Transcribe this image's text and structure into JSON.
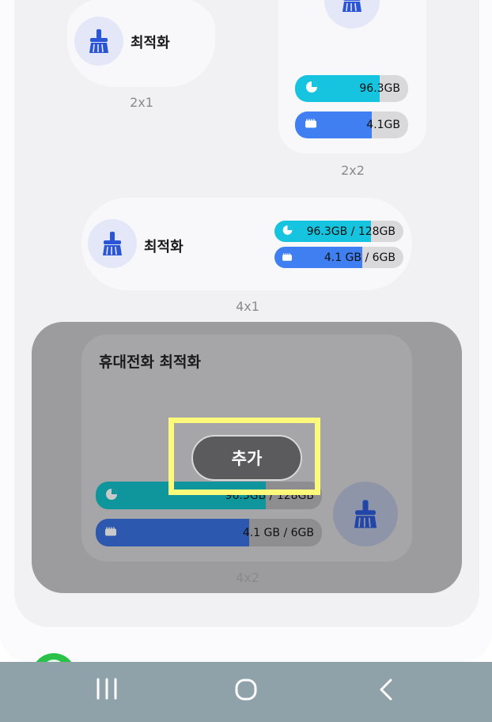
{
  "widgets": {
    "w2x1": {
      "title": "최적화",
      "size": "2x1"
    },
    "w2x2": {
      "storage_value": "96.3GB",
      "ram_value": "4.1GB",
      "size": "2x2",
      "storage_fill": 0.75,
      "ram_fill": 0.68
    },
    "w4x1": {
      "title": "최적화",
      "storage_value": "96.3GB / 128GB",
      "ram_value": "4.1 GB / 6GB",
      "size": "4x1",
      "storage_fill": 0.75,
      "ram_fill": 0.68
    },
    "w4x2": {
      "title": "휴대전화 최적화",
      "storage_value": "96.3GB / 128GB",
      "ram_value": "4.1 GB / 6GB",
      "size": "4x2",
      "add_label": "추가",
      "storage_fill": 0.75,
      "ram_fill": 0.68
    }
  },
  "colors": {
    "storage": "#17c4df",
    "ram": "#3f7ff2",
    "storage_dim": "#0f959c",
    "ram_dim": "#2c58b0",
    "brush": "#2a55d6",
    "highlight": "#fdf97a",
    "navbar": "#8fa2aa"
  },
  "icons": [
    "broom-icon",
    "pie-chart-icon",
    "memory-chip-icon",
    "recent-apps-icon",
    "home-icon",
    "back-icon"
  ]
}
